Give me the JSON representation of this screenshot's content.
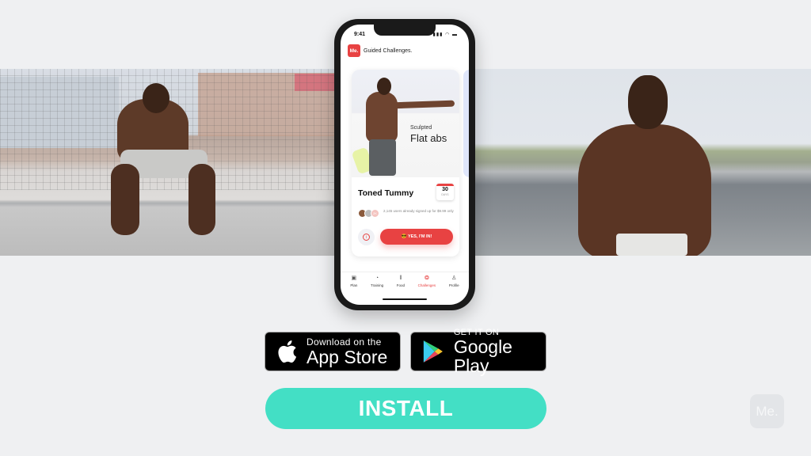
{
  "phone": {
    "status_time": "9:41",
    "status_icons": "signal wifi battery",
    "app_logo": "Me.",
    "app_title": "Guided Challenges.",
    "card": {
      "subtitle": "Sculpted",
      "headline": "Flat abs",
      "challenge_name": "Toned Tummy",
      "duration_number": "30",
      "duration_unit": "DAYS",
      "avatar_badge": "2K",
      "signup_text": "2,145 users already signed up for $9.99 only",
      "info_icon": "i",
      "cta_label": "😎 YES, I'M IN!"
    },
    "tabs": [
      {
        "label": "Plan",
        "icon": "▣",
        "active": false
      },
      {
        "label": "Training",
        "icon": "◔",
        "active": false
      },
      {
        "label": "Food",
        "icon": "‖",
        "active": false
      },
      {
        "label": "Challenges",
        "icon": "❂",
        "active": true
      },
      {
        "label": "Profile",
        "icon": "♙",
        "active": false
      }
    ],
    "accent_color": "#e84242"
  },
  "badges": {
    "appstore_small": "Download on the",
    "appstore_big": "App Store",
    "gplay_small": "GET IT ON",
    "gplay_big": "Google Play"
  },
  "install_label": "INSTALL",
  "install_color": "#43dfc5",
  "watermark": "Me."
}
